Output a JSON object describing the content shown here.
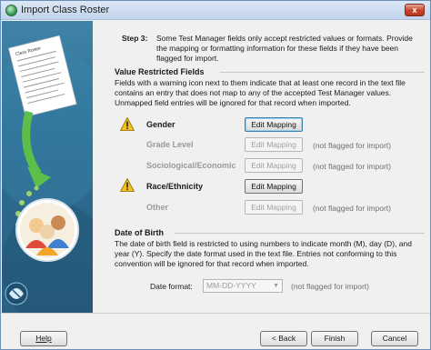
{
  "window": {
    "title": "Import Class Roster",
    "close_glyph": "x"
  },
  "step": {
    "label": "Step 3:",
    "text": "Some Test Manager fields only accept restricted values or formats.  Provide the mapping or formatting information for these fields if they have been flagged for import."
  },
  "value_restricted": {
    "title": "Value Restricted Fields",
    "description": "Fields with a warning icon next to them indicate that at least one record in the text file contains an entry that does not map to any of the accepted Test Manager values.  Unmapped field entries will be ignored for that record when imported.",
    "fields": [
      {
        "label": "Gender",
        "button": "Edit Mapping",
        "note": ""
      },
      {
        "label": "Grade Level",
        "button": "Edit Mapping",
        "note": "(not flagged for import)"
      },
      {
        "label": "Sociological/Economic",
        "button": "Edit Mapping",
        "note": "(not flagged for import)"
      },
      {
        "label": "Race/Ethnicity",
        "button": "Edit Mapping",
        "note": ""
      },
      {
        "label": "Other",
        "button": "Edit Mapping",
        "note": "(not flagged for import)"
      }
    ]
  },
  "date_of_birth": {
    "title": "Date of Birth",
    "description": "The date of birth field is restricted to using numbers to indicate month (M), day (D), and year (Y).  Specify the date format used in the text file.  Entries not conforming to this convention will be ignored for that record when imported.",
    "format_label": "Date format:",
    "format_value": "MM-DD-YYYY",
    "note": "(not flagged for import)"
  },
  "footer": {
    "help": "Help",
    "back": "< Back",
    "finish": "Finish",
    "cancel": "Cancel"
  },
  "sidebar_document": {
    "heading": "Class Roster"
  },
  "colors": {
    "sidebar": "#2d6d92",
    "warning": "#f2c21b",
    "arrow": "#5cbf4a"
  }
}
